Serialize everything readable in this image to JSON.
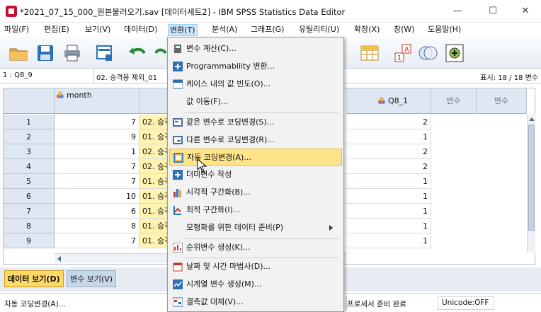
{
  "window": {
    "title": "*2021_07_15_000_원본불러오기.sav [데이터세트2] - IBM SPSS Statistics Data Editor",
    "minimize_glyph": "—",
    "maximize_glyph": "☐",
    "close_glyph": "✕"
  },
  "menubar": {
    "items": [
      "파일(F)",
      "편집(E)",
      "보기(V)",
      "데이터(D)",
      "변환(T)",
      "분석(A)",
      "그래프(G)",
      "유틸리티(U)",
      "확장(X)",
      "창(W)",
      "도움말(H)"
    ]
  },
  "cellbar": {
    "ref": "1 : Q8_9",
    "value": "02. 승격용 제외_01",
    "show_count": "표시: 18 / 18 변수"
  },
  "grid": {
    "col_month": "month",
    "col_q8_1": "Q8_1",
    "col_var1": "변수",
    "col_var2": "변수",
    "rows": [
      {
        "n": "1",
        "month": "7",
        "q89": "02. 승격",
        "q81": "2"
      },
      {
        "n": "2",
        "month": "9",
        "q89": "01. 승격",
        "q81": "1"
      },
      {
        "n": "3",
        "month": "1",
        "q89": "02. 승격",
        "q81": "2"
      },
      {
        "n": "4",
        "month": "7",
        "q89": "02. 승격",
        "q81": "2"
      },
      {
        "n": "5",
        "month": "7",
        "q89": "01. 승격",
        "q81": "1"
      },
      {
        "n": "6",
        "month": "10",
        "q89": "01. 승격",
        "q81": "1"
      },
      {
        "n": "7",
        "month": "6",
        "q89": "01. 승격",
        "q81": "1"
      },
      {
        "n": "8",
        "month": "8",
        "q89": "01. 승격",
        "q81": "1"
      },
      {
        "n": "9",
        "month": "7",
        "q89": "01. 승격",
        "q81": "1"
      }
    ]
  },
  "tabs": {
    "data_view": "데이터 보기(D)",
    "variable_view": "변수 보기(V)"
  },
  "status": {
    "left": "자동 코딩변경(A)...",
    "processor": "프로세서 준비 완료",
    "unicode": "Unicode:OFF"
  },
  "transform_menu": {
    "items": [
      {
        "label": "변수 계산(C)...",
        "icon": "calculator-icon"
      },
      {
        "label": "Programmability 변환...",
        "icon": "plus-icon"
      },
      {
        "label": "케이스 내의 값 빈도(O)...",
        "icon": "table-icon"
      },
      {
        "label": "값 이동(F)...",
        "icon": ""
      },
      {
        "label": "같은 변수로 코딩변경(S)...",
        "icon": "recode-icon"
      },
      {
        "label": "다른 변수로 코딩변경(R)...",
        "icon": "recode-icon"
      },
      {
        "label": "자동 코딩변경(A)...",
        "icon": "auto-recode-icon"
      },
      {
        "label": "더미변수 작성",
        "icon": "plus-icon"
      },
      {
        "label": "시각적 구간화(B)...",
        "icon": "bin-icon"
      },
      {
        "label": "최적 구간화(I)...",
        "icon": "optimal-bin-icon"
      },
      {
        "label": "모형화를 위한 데이터 준비(P)",
        "icon": ""
      },
      {
        "label": "순위변수 생성(K)...",
        "icon": "rank-icon"
      },
      {
        "label": "날짜 및 시간 마법사(D)...",
        "icon": "calendar-icon"
      },
      {
        "label": "시계열 변수 생성(M)...",
        "icon": "chart-icon"
      },
      {
        "label": "결측값 대체(V)...",
        "icon": "replace-icon"
      }
    ]
  },
  "colors": {
    "highlight": "#ffe48a",
    "grid_header": "#dfe8f2",
    "tab_active": "#ffd966"
  }
}
